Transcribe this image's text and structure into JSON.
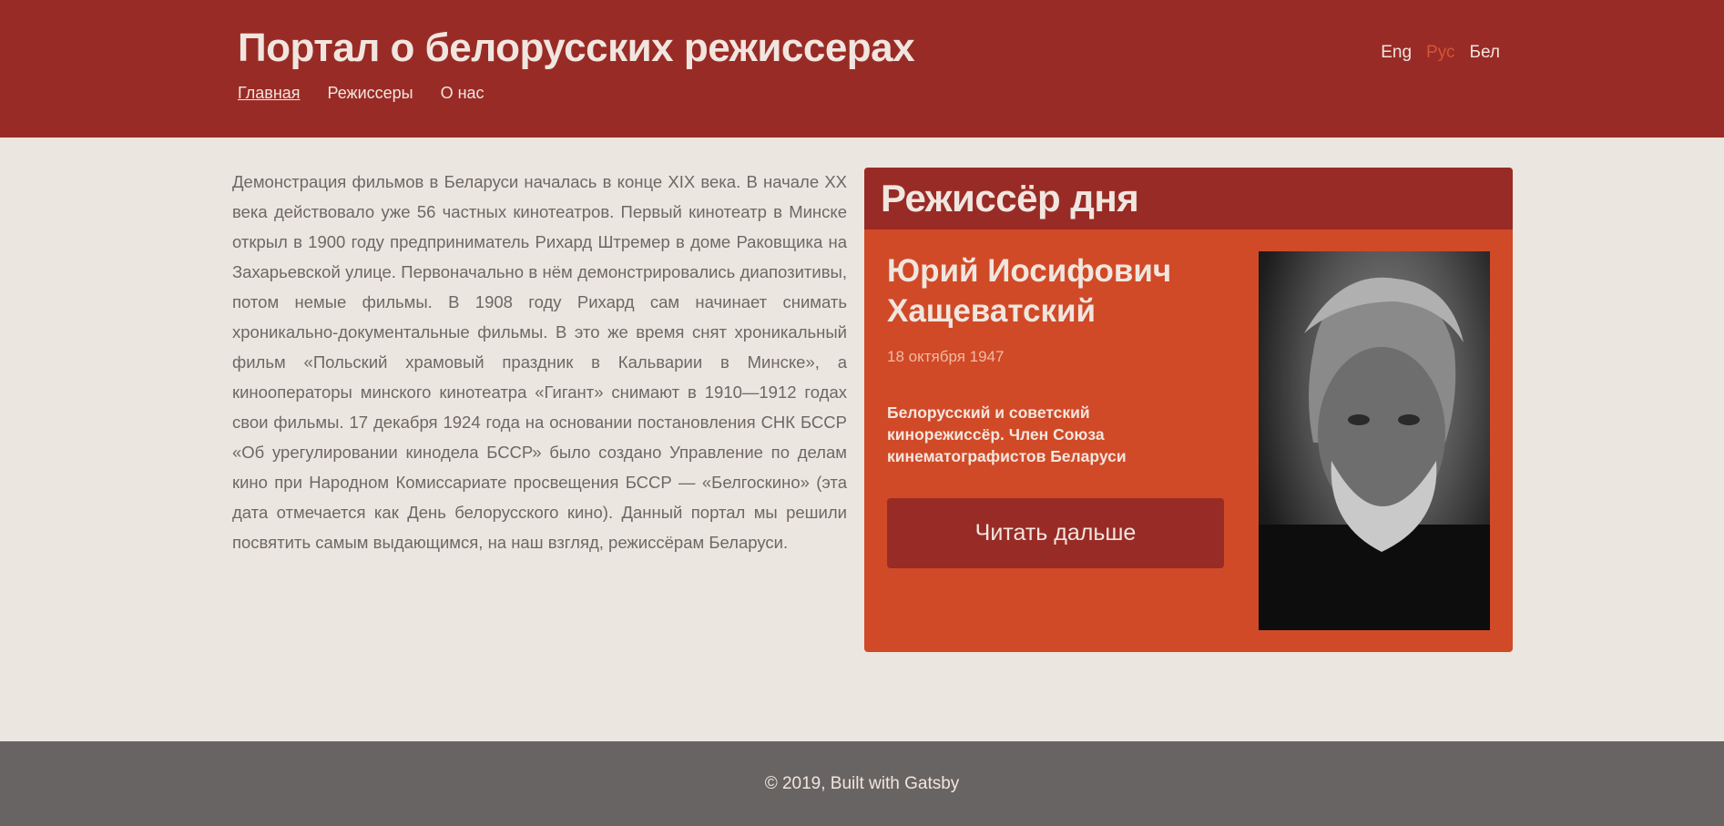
{
  "header": {
    "title": "Портал о белорусских режиссерах",
    "nav": [
      "Главная",
      "Режиссеры",
      "О нас"
    ],
    "languages": [
      "Eng",
      "Рус",
      "Бел"
    ]
  },
  "intro": "Демонстрация фильмов в Беларуси началась в конце XIX века. В начале XX века действовало уже 56 частных кинотеатров. Первый кинотеатр в Минске открыл в 1900 году предприниматель Рихард Штремер в доме Раковщика на Захарьевской улице. Первоначально в нём демонстрировались диапозитивы, потом немые фильмы. В 1908 году Рихард сам начинает снимать хроникально-документальные фильмы. В это же время снят хроникальный фильм «Польский храмовый праздник в Кальварии в Минске», а кинооператоры минского кинотеатра «Гигант» снимают в 1910—1912 годах свои фильмы. 17 декабря 1924 года на основании постановления СНК БССР «Об урегулировании кинодела БССР» было создано Управление по делам кино при Народном Комиссариате просвещения БССР — «Белгоскино» (эта дата отмечается как День белорусского кино). Данный портал мы решили посвятить самым выдающимся, на наш взгляд, режиссёрам Беларуси.",
  "director_of_day": {
    "heading": "Режиссёр дня",
    "name": "Юрий Иосифович Хащеватский",
    "date": "18 октября 1947",
    "bio": "Белорусский и советский кинорежиссёр. Член Союза кинематографистов Беларуси",
    "button": "Читать дальше"
  },
  "footer": {
    "text": "© 2019, Built with Gatsby"
  },
  "colors": {
    "header_bg": "#992b26",
    "card_bg": "#d04a27",
    "page_bg": "#ebe6df",
    "footer_bg": "#686463",
    "active_lang": "#d4543a"
  }
}
